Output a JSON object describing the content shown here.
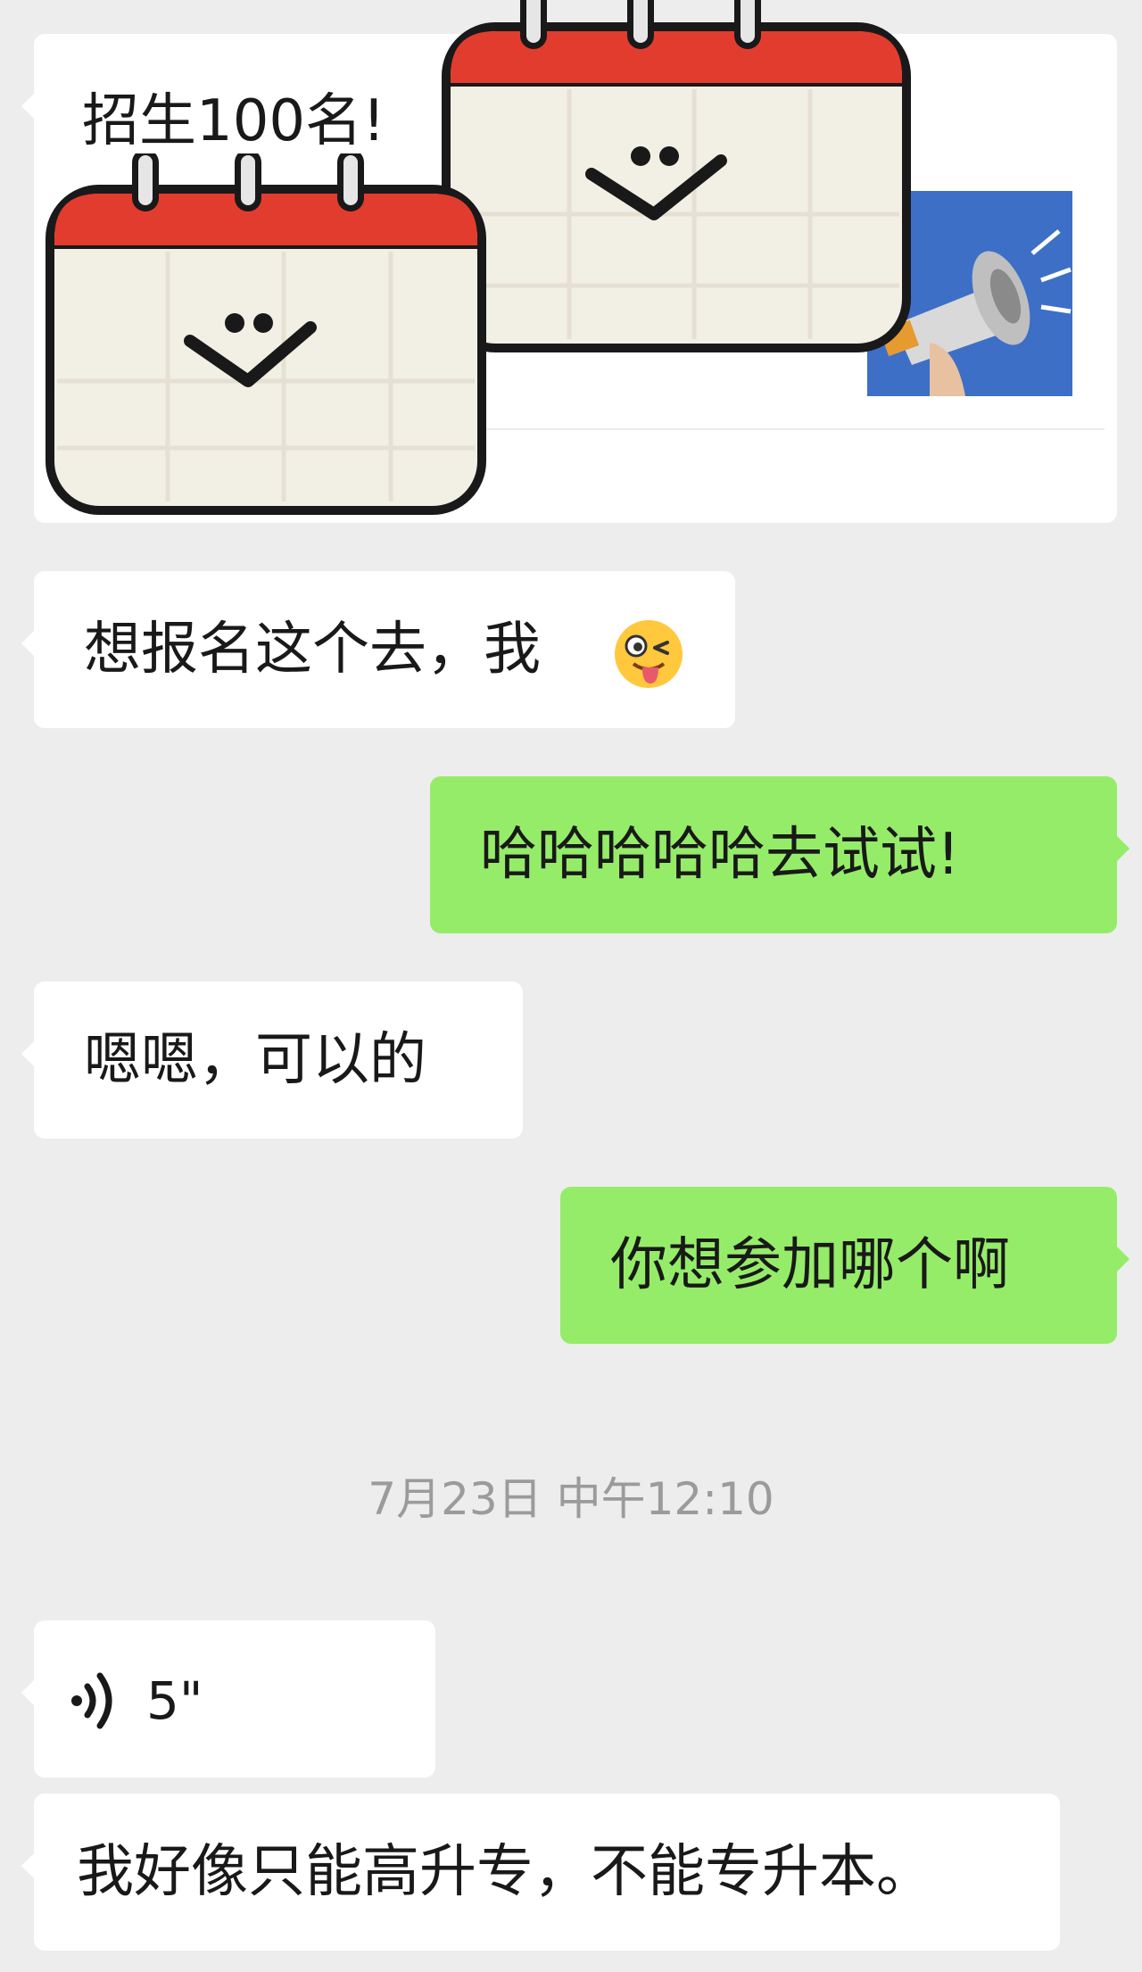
{
  "messages": [
    {
      "side": "in",
      "type": "card",
      "title": "招生100名!"
    },
    {
      "side": "in",
      "type": "text",
      "text": "想报名这个去，我",
      "emoji": "winking-tongue-face-icon"
    },
    {
      "side": "out",
      "type": "text",
      "text": "哈哈哈哈哈去试试!"
    },
    {
      "side": "in",
      "type": "text",
      "text": "嗯嗯，可以的"
    },
    {
      "side": "out",
      "type": "text",
      "text": "你想参加哪个啊"
    },
    {
      "side": "in",
      "type": "voice",
      "duration": "5\""
    },
    {
      "side": "in",
      "type": "text",
      "text": "我好像只能高升专，不能专升本。"
    }
  ],
  "timestamp": "7月23日 中午12:10",
  "colors": {
    "background": "#ededed",
    "incoming": "#ffffff",
    "outgoing": "#95ec69",
    "timestamp": "#9b9b9b"
  }
}
